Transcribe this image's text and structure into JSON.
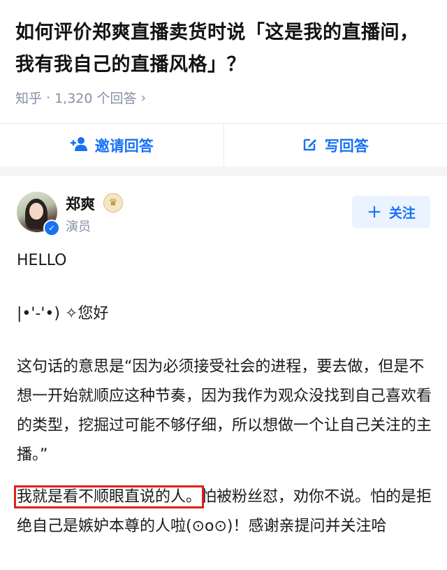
{
  "question": {
    "title": "如何评价郑爽直播卖货时说「这是我的直播间，我有我自己的直播风格」？",
    "source": "知乎",
    "separator": "·",
    "answer_count": "1,320 个回答",
    "chevron": "›"
  },
  "actions": {
    "invite_label": "邀请回答",
    "write_label": "写回答"
  },
  "author": {
    "name": "郑爽",
    "role": "演员",
    "follow_label": "关注",
    "follow_plus": "+"
  },
  "answer": {
    "p1": "HELLO",
    "p2": "|•'-'•) ✧您好",
    "p3": "这句话的意思是“因为必须接受社会的进程，要去做，但是不想一开始就顺应这种节奏，因为我作为观众没找到自己喜欢看的类型，挖掘过可能不够仔细，所以想做一个让自己关注的主播。”",
    "p4_highlight": "我就是看不顺眼直说的人。",
    "p4_rest": "怕被粉丝怼，劝你不说。怕的是拒绝自己是嫉妒本尊的人啦(⊙o⊙)！感谢亲提问并关注哈"
  },
  "colors": {
    "accent": "#1772f6",
    "highlight_box": "#e02020",
    "meta_gray": "#8590a6"
  }
}
